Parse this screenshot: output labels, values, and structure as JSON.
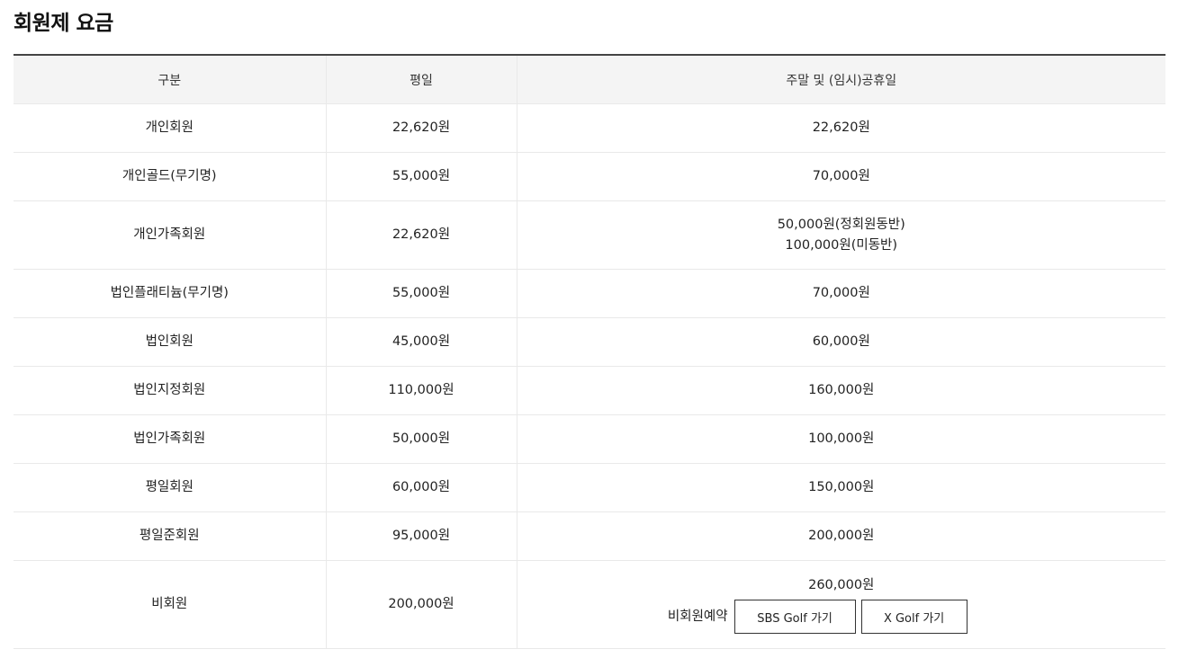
{
  "page": {
    "title": "회원제 요금"
  },
  "table": {
    "headers": [
      "구분",
      "평일",
      "주말 및 (임시)공휴일"
    ],
    "rows": [
      {
        "type": "개인회원",
        "weekday": "22,620원",
        "weekend": [
          "22,620원"
        ]
      },
      {
        "type": "개인골드(무기명)",
        "weekday": "55,000원",
        "weekend": [
          "70,000원"
        ]
      },
      {
        "type": "개인가족회원",
        "weekday": "22,620원",
        "weekend": [
          "50,000원(정회원동반)",
          "100,000원(미동반)"
        ]
      },
      {
        "type": "법인플래티늄(무기명)",
        "weekday": "55,000원",
        "weekend": [
          "70,000원"
        ]
      },
      {
        "type": "법인회원",
        "weekday": "45,000원",
        "weekend": [
          "60,000원"
        ]
      },
      {
        "type": "법인지정회원",
        "weekday": "110,000원",
        "weekend": [
          "160,000원"
        ]
      },
      {
        "type": "법인가족회원",
        "weekday": "50,000원",
        "weekend": [
          "100,000원"
        ]
      },
      {
        "type": "평일회원",
        "weekday": "60,000원",
        "weekend": [
          "150,000원"
        ]
      },
      {
        "type": "평일준회원",
        "weekday": "95,000원",
        "weekend": [
          "200,000원"
        ]
      },
      {
        "type": "비회원",
        "weekday": "200,000원",
        "weekend": [
          "260,000원"
        ]
      }
    ]
  },
  "reservation": {
    "label": "비회원예약",
    "sbs_button": "SBS Golf 가기",
    "xgolf_button": "X Golf 가기"
  }
}
